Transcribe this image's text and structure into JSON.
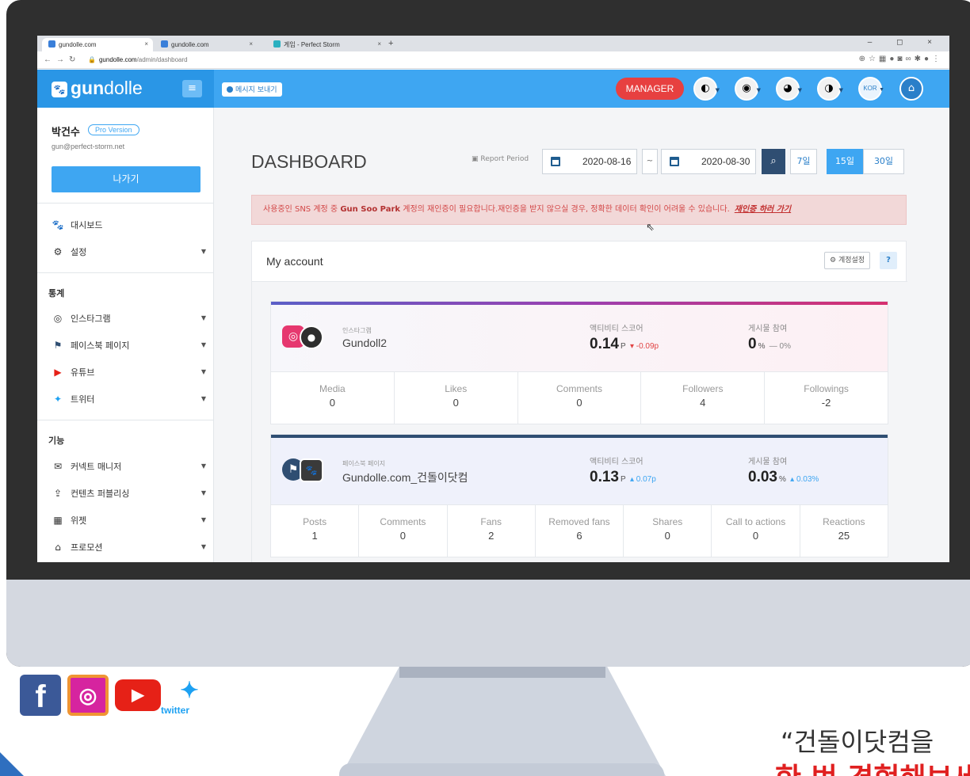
{
  "browser": {
    "tabs": [
      {
        "label": "gundolle.com",
        "active": true
      },
      {
        "label": "gundolle.com",
        "active": false
      },
      {
        "label": "게임 - Perfect Storm",
        "active": false
      }
    ],
    "new_tab": "+",
    "url_host": "gundolle.com",
    "url_path": "/admin/dashboard"
  },
  "header": {
    "logo_bold": "gun",
    "logo_light": "dolle",
    "menu_icon": "hamburger-icon",
    "send_message": "메시지 보내기",
    "manager": "MANAGER",
    "lang": "KOR"
  },
  "sidebar": {
    "user_name": "박건수",
    "badge": "Pro Version",
    "email": "gun@perfect-storm.net",
    "logout": "나가기",
    "menu": [
      {
        "label": "대시보드",
        "icon": "paw-icon"
      },
      {
        "label": "설정",
        "icon": "gear-icon"
      }
    ],
    "stats_heading": "통계",
    "stats": [
      {
        "label": "인스타그램",
        "icon": "instagram-icon"
      },
      {
        "label": "페이스북 페이지",
        "icon": "flag-icon"
      },
      {
        "label": "유튜브",
        "icon": "youtube-icon"
      },
      {
        "label": "트위터",
        "icon": "twitter-icon"
      }
    ],
    "func_heading": "기능",
    "funcs": [
      {
        "label": "커넥트 매니저",
        "icon": "chat-icon"
      },
      {
        "label": "컨텐츠 퍼블리싱",
        "icon": "upload-icon"
      },
      {
        "label": "위젯",
        "icon": "grid-icon"
      },
      {
        "label": "프로모션",
        "icon": "gift-icon"
      }
    ]
  },
  "dashboard": {
    "title": "DASHBOARD",
    "report_period": "Report Period",
    "start_date": "2020-08-16",
    "tilde": "~",
    "end_date": "2020-08-30",
    "periods": [
      "7일",
      "15일",
      "30일"
    ],
    "active_period": "15일"
  },
  "alert": {
    "prefix": "사용중인 SNS 계정 중",
    "account": "Gun Soo Park",
    "suffix": "계정의 재인증이 필요합니다.재인증을 받지 않으실 경우, 정확한 데이터 확인이 어려울 수 있습니다.",
    "link": "재인증 하러 가기"
  },
  "my_account": {
    "title": "My account",
    "settings": "계정설정",
    "help": "?",
    "accounts": [
      {
        "type": "인스타그램",
        "name": "Gundoll2",
        "activity_label": "액티비티 스코어",
        "activity_value": "0.14",
        "activity_unit": "P",
        "activity_change": "▾ -0.09p",
        "post_label": "게시물 참여",
        "post_value": "0",
        "post_unit": "%",
        "post_change": "— 0%",
        "stats": [
          {
            "label": "Media",
            "value": "0"
          },
          {
            "label": "Likes",
            "value": "0"
          },
          {
            "label": "Comments",
            "value": "0"
          },
          {
            "label": "Followers",
            "value": "4"
          },
          {
            "label": "Followings",
            "value": "-2"
          }
        ]
      },
      {
        "type": "페이스북 페이지",
        "name": "Gundolle.com_건돌이닷컴",
        "activity_label": "액티비티 스코어",
        "activity_value": "0.13",
        "activity_unit": "P",
        "activity_change": "▴ 0.07p",
        "post_label": "게시물 참여",
        "post_value": "0.03",
        "post_unit": "%",
        "post_change": "▴ 0.03%",
        "stats": [
          {
            "label": "Posts",
            "value": "1"
          },
          {
            "label": "Comments",
            "value": "0"
          },
          {
            "label": "Fans",
            "value": "2"
          },
          {
            "label": "Removed fans",
            "value": "6"
          },
          {
            "label": "Shares",
            "value": "0"
          },
          {
            "label": "Call to actions",
            "value": "0"
          },
          {
            "label": "Reactions",
            "value": "25"
          }
        ]
      }
    ]
  },
  "footer": {
    "twitter_label": "twitter",
    "quote_line1": "“건돌이닷컴을",
    "quote_line2": "한 번 경험해보세요"
  },
  "colors": {
    "brand_blue": "#3ea6f2",
    "alert_red": "#d34848",
    "manager_red": "#e74040"
  }
}
